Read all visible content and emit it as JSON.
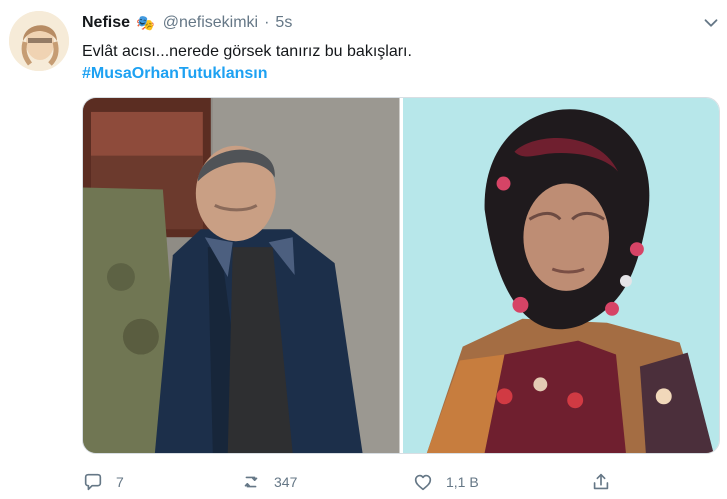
{
  "tweet": {
    "display_name": "Nefise",
    "name_emoji": "🎭",
    "handle": "@nefisekimki",
    "separator": "·",
    "time": "5s",
    "text": "Evlât acısı...nerede görsek tanırız bu bakışları.",
    "hashtag": "#MusaOrhanTutuklansın",
    "media": [
      {
        "icon": "photo-man"
      },
      {
        "icon": "photo-woman"
      }
    ],
    "actions": {
      "replies": "7",
      "retweets": "347",
      "likes": "1,1 B"
    }
  },
  "colors": {
    "link": "#1da1f2",
    "secondary_text": "#657786",
    "primary_text": "#14171a"
  }
}
